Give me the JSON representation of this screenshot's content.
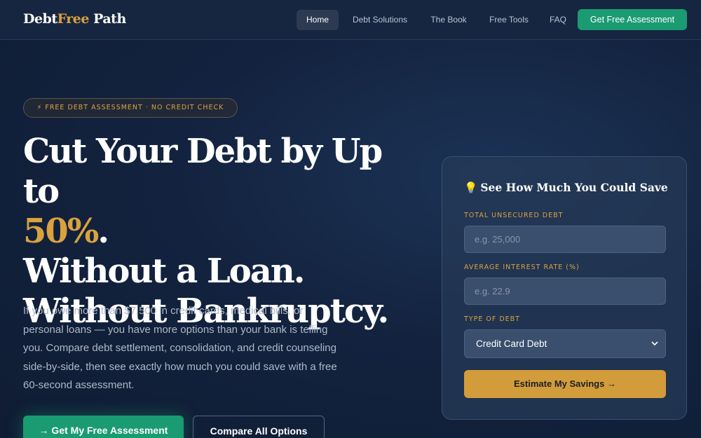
{
  "brand": {
    "part1": "Debt",
    "part2": "Free",
    "part3": " Path"
  },
  "nav": {
    "links": [
      "Home",
      "Debt Solutions",
      "The Book",
      "Free Tools",
      "FAQ"
    ],
    "cta": "Get Free Assessment"
  },
  "hero": {
    "badge": "⚡ FREE DEBT ASSESSMENT · NO CREDIT CHECK",
    "headline_line1": "Cut Your Debt by Up to",
    "headline_gold": "50%",
    "headline_dot": ".",
    "headline_line3": "Without a Loan.",
    "headline_line4": "Without Bankruptcy.",
    "lead": "If you owe more than $7,500 in credit cards, medical bills, or personal loans — you have more options than your bank is telling you. Compare debt settlement, consolidation, and credit counseling side-by-side, then see exactly how much you could save with a free 60-second assessment.",
    "primary_button": "→ Get My Free Assessment",
    "secondary_button": "Compare All Options"
  },
  "calculator": {
    "title_icon": "💡",
    "title": "See How Much You Could Save",
    "debt_label": "TOTAL UNSECURED DEBT",
    "debt_placeholder": "e.g. 25,000",
    "rate_label": "AVERAGE INTEREST RATE (%)",
    "rate_placeholder": "e.g. 22.9",
    "type_label": "TYPE OF DEBT",
    "type_selected": "Credit Card Debt",
    "submit": "Estimate My Savings →"
  },
  "colors": {
    "accent_gold": "#d9a23f",
    "accent_green": "#1a9b72",
    "background": "#13233f"
  },
  "icons": [
    "lightning-icon",
    "lightbulb-icon",
    "chevron-down-icon",
    "arrow-right-icon"
  ]
}
